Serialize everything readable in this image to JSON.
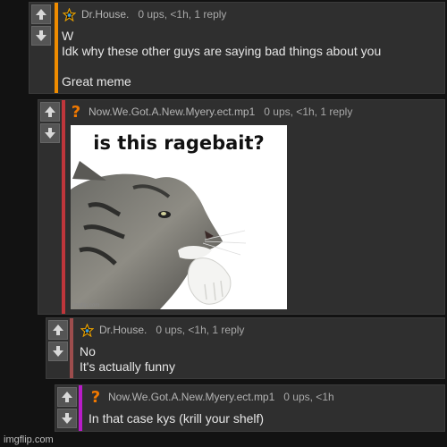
{
  "comments": [
    {
      "user": "Dr.House.",
      "meta": "0 ups, <1h, 1 reply",
      "lines": [
        "W",
        "Idk why these other guys are saying bad things about you",
        "",
        "Great meme"
      ],
      "bar_color": "#f08c00",
      "icon": "star-icon"
    },
    {
      "user": "Now.We.Got.A.New.Myery.ect.mp1",
      "meta": "0 ups, <1h, 1 reply",
      "image_caption": "is this ragebait?",
      "image_watermark": "imgflip.com",
      "bar_color": "#c0363b",
      "icon": "question-icon"
    },
    {
      "user": "Dr.House.",
      "meta": "0 ups, <1h, 1 reply",
      "lines": [
        "No",
        "It's actually funny"
      ],
      "bar_color": "#9e4d4d",
      "icon": "star-icon"
    },
    {
      "user": "Now.We.Got.A.New.Myery.ect.mp1",
      "meta": "0 ups, <1h",
      "lines": [
        "In that case kys (krill your shelf)"
      ],
      "bar_color": "#b81cc8",
      "icon": "question-icon"
    }
  ],
  "footer": "imgflip.com"
}
